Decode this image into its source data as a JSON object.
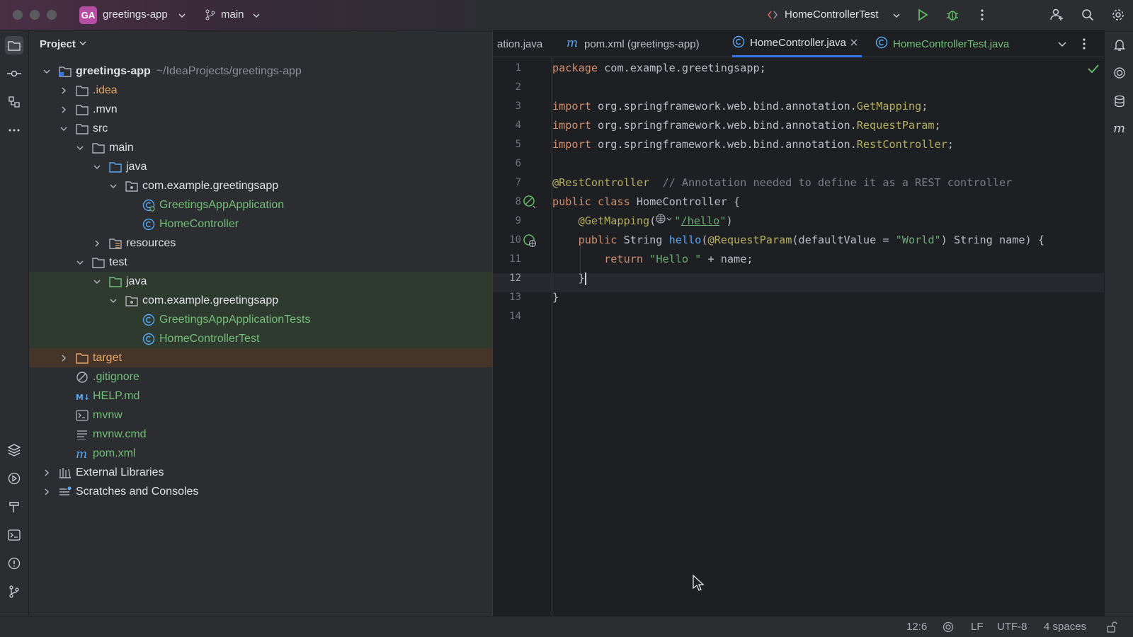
{
  "titlebar": {
    "project_badge": "GA",
    "project_name": "greetings-app",
    "branch": "main",
    "run_config": "HomeControllerTest"
  },
  "project_panel": {
    "title": "Project",
    "tree": [
      {
        "label": "greetings-app",
        "path": "~/IdeaProjects/greetings-app"
      },
      {
        "label": ".idea"
      },
      {
        "label": ".mvn"
      },
      {
        "label": "src"
      },
      {
        "label": "main"
      },
      {
        "label": "java"
      },
      {
        "label": "com.example.greetingsapp"
      },
      {
        "label": "GreetingsAppApplication"
      },
      {
        "label": "HomeController"
      },
      {
        "label": "resources"
      },
      {
        "label": "test"
      },
      {
        "label": "java"
      },
      {
        "label": "com.example.greetingsapp"
      },
      {
        "label": "GreetingsAppApplicationTests"
      },
      {
        "label": "HomeControllerTest"
      },
      {
        "label": "target"
      },
      {
        "label": ".gitignore"
      },
      {
        "label": "HELP.md"
      },
      {
        "label": "mvnw"
      },
      {
        "label": "mvnw.cmd"
      },
      {
        "label": "pom.xml"
      },
      {
        "label": "External Libraries"
      },
      {
        "label": "Scratches and Consoles"
      }
    ]
  },
  "editor": {
    "tabs": [
      {
        "label": "ation.java"
      },
      {
        "label": "pom.xml (greetings-app)"
      },
      {
        "label": "HomeController.java"
      },
      {
        "label": "HomeControllerTest.java"
      }
    ],
    "line_numbers": [
      "1",
      "2",
      "3",
      "4",
      "5",
      "6",
      "7",
      "8",
      "9",
      "10",
      "11",
      "12",
      "13",
      "14"
    ],
    "code": {
      "l1_kw": "package",
      "l1_rest": " com.example.greetingsapp;",
      "l3_kw": "import",
      "l3_pkg": " org.springframework.web.bind.annotation.",
      "l3_cls": "GetMapping",
      "l4_kw": "import",
      "l4_pkg": " org.springframework.web.bind.annotation.",
      "l4_cls": "RequestParam",
      "l5_kw": "import",
      "l5_pkg": " org.springframework.web.bind.annotation.",
      "l5_cls": "RestController",
      "l7_ann": "@RestController",
      "l7_cmt": "  // Annotation needed to define it as a REST controller",
      "l8_kw": "public class",
      "l8_rest": " HomeController {",
      "l9_ann": "    @GetMapping",
      "l9_open": "(",
      "l9_str1": "\"",
      "l9_path": "/hello",
      "l9_str2": "\"",
      "l9_close": ")",
      "l10_kw": "    public",
      "l10_type": " String ",
      "l10_fn": "hello",
      "l10_p1": "(",
      "l10_ann": "@RequestParam",
      "l10_p2": "(defaultValue = ",
      "l10_str": "\"World\"",
      "l10_p3": ") String name) {",
      "l11_kw": "        return",
      "l11_sp": " ",
      "l11_str": "\"Hello \"",
      "l11_rest": " + name;",
      "l12": "    }",
      "l13": "}"
    }
  },
  "statusbar": {
    "position": "12:6",
    "line_sep": "LF",
    "encoding": "UTF-8",
    "indent": "4 spaces"
  }
}
